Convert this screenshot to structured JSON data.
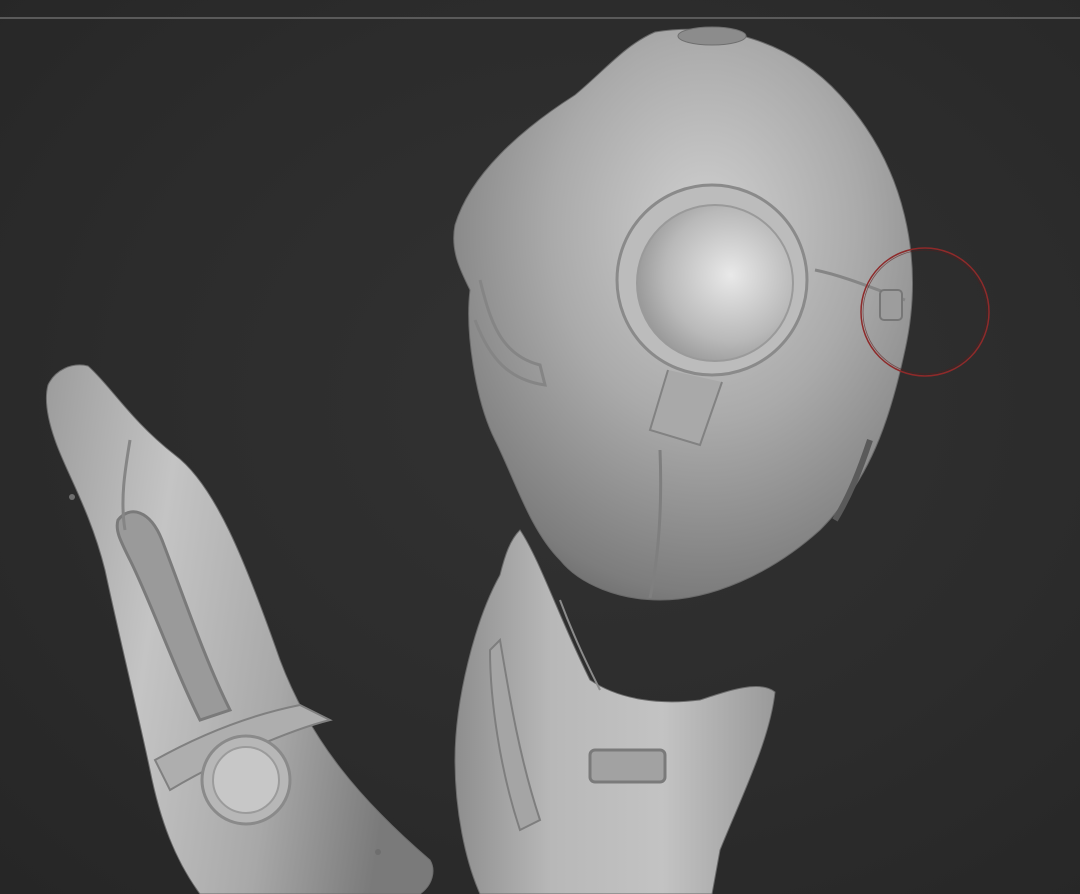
{
  "viewport": {
    "background": "#2c2c2c",
    "divider_color": "#5a5a5a",
    "mesh_color": "#b4b4b4",
    "brush_cursor_color": "#9a2a2a"
  },
  "scene": {
    "objects": [
      "helmet-mesh",
      "forearm-mesh",
      "neck-mesh"
    ],
    "tool": "brush-cursor"
  }
}
